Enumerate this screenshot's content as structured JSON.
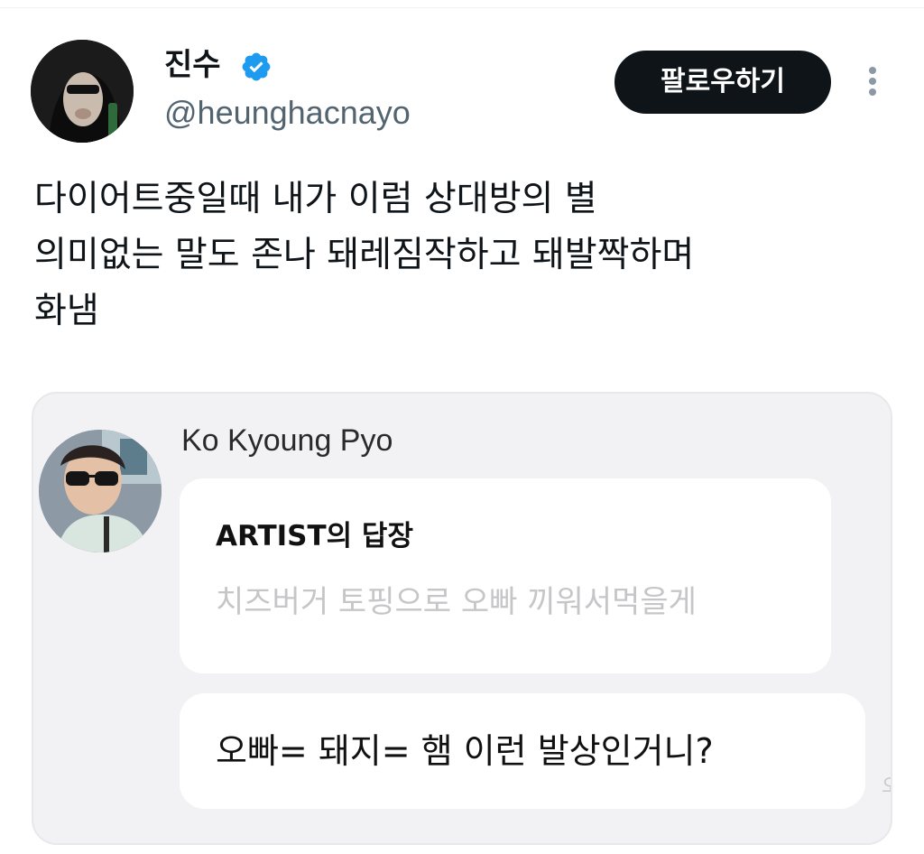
{
  "author": {
    "display_name": "진수",
    "handle": "@heunghacnayo",
    "verified_icon": "verified-badge-icon"
  },
  "actions": {
    "follow_label": "팔로우하기",
    "more_icon": "more-vertical-icon"
  },
  "tweet": {
    "text": "다이어트중일때 내가 이럼 상대방의 별\n의미없는 말도 존나 돼레짐작하고 돼발짝하며\n화냄"
  },
  "media": {
    "sender_name": "Ko Kyoung Pyo",
    "reply_card": {
      "title": "ARTIST의 답장",
      "quoted_text": "치즈버거 토핑으로 오빠 끼워서먹을게"
    },
    "message": "오빠= 돼지= 햄 이런 발상인거니?",
    "edge_char": "오"
  },
  "colors": {
    "verified_blue": "#1d9bf0",
    "follow_bg": "#0f1419",
    "handle_gray": "#536471",
    "chat_bg": "#f2f2f4"
  }
}
